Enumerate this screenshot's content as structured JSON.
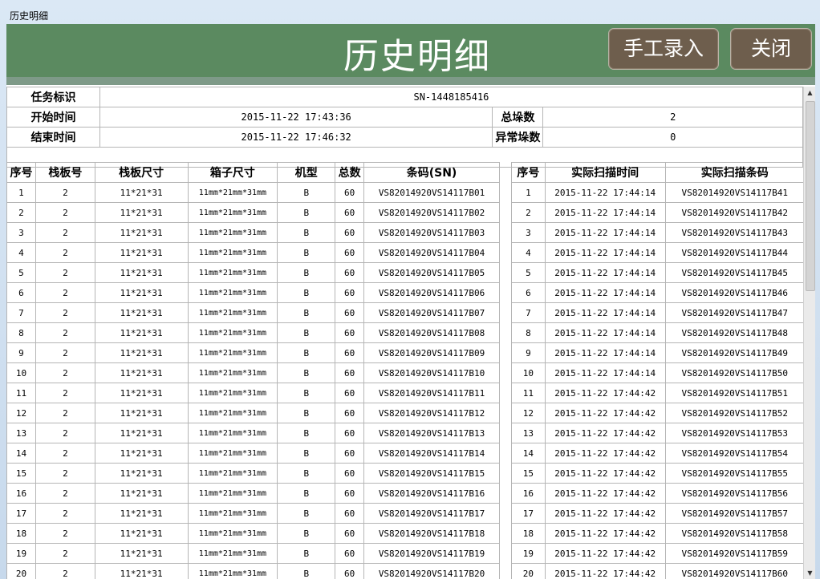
{
  "window": {
    "title": "历史明细"
  },
  "header": {
    "title": "历史明细",
    "manual_entry_label": "手工录入",
    "close_label": "关闭"
  },
  "info": {
    "task_id_label": "任务标识",
    "task_id": "SN-1448185416",
    "start_label": "开始时间",
    "start_time": "2015-11-22 17:43:36",
    "end_label": "结束时间",
    "end_time": "2015-11-22 17:46:32",
    "total_label": "总垛数",
    "total": "2",
    "abnormal_label": "异常垛数",
    "abnormal": "0"
  },
  "left_table": {
    "headers": [
      "序号",
      "栈板号",
      "栈板尺寸",
      "箱子尺寸",
      "机型",
      "总数",
      "条码(SN)"
    ],
    "rows": [
      [
        "1",
        "2",
        "11*21*31",
        "11mm*21mm*31mm",
        "B",
        "60",
        "VS82014920VS14117B01"
      ],
      [
        "2",
        "2",
        "11*21*31",
        "11mm*21mm*31mm",
        "B",
        "60",
        "VS82014920VS14117B02"
      ],
      [
        "3",
        "2",
        "11*21*31",
        "11mm*21mm*31mm",
        "B",
        "60",
        "VS82014920VS14117B03"
      ],
      [
        "4",
        "2",
        "11*21*31",
        "11mm*21mm*31mm",
        "B",
        "60",
        "VS82014920VS14117B04"
      ],
      [
        "5",
        "2",
        "11*21*31",
        "11mm*21mm*31mm",
        "B",
        "60",
        "VS82014920VS14117B05"
      ],
      [
        "6",
        "2",
        "11*21*31",
        "11mm*21mm*31mm",
        "B",
        "60",
        "VS82014920VS14117B06"
      ],
      [
        "7",
        "2",
        "11*21*31",
        "11mm*21mm*31mm",
        "B",
        "60",
        "VS82014920VS14117B07"
      ],
      [
        "8",
        "2",
        "11*21*31",
        "11mm*21mm*31mm",
        "B",
        "60",
        "VS82014920VS14117B08"
      ],
      [
        "9",
        "2",
        "11*21*31",
        "11mm*21mm*31mm",
        "B",
        "60",
        "VS82014920VS14117B09"
      ],
      [
        "10",
        "2",
        "11*21*31",
        "11mm*21mm*31mm",
        "B",
        "60",
        "VS82014920VS14117B10"
      ],
      [
        "11",
        "2",
        "11*21*31",
        "11mm*21mm*31mm",
        "B",
        "60",
        "VS82014920VS14117B11"
      ],
      [
        "12",
        "2",
        "11*21*31",
        "11mm*21mm*31mm",
        "B",
        "60",
        "VS82014920VS14117B12"
      ],
      [
        "13",
        "2",
        "11*21*31",
        "11mm*21mm*31mm",
        "B",
        "60",
        "VS82014920VS14117B13"
      ],
      [
        "14",
        "2",
        "11*21*31",
        "11mm*21mm*31mm",
        "B",
        "60",
        "VS82014920VS14117B14"
      ],
      [
        "15",
        "2",
        "11*21*31",
        "11mm*21mm*31mm",
        "B",
        "60",
        "VS82014920VS14117B15"
      ],
      [
        "16",
        "2",
        "11*21*31",
        "11mm*21mm*31mm",
        "B",
        "60",
        "VS82014920VS14117B16"
      ],
      [
        "17",
        "2",
        "11*21*31",
        "11mm*21mm*31mm",
        "B",
        "60",
        "VS82014920VS14117B17"
      ],
      [
        "18",
        "2",
        "11*21*31",
        "11mm*21mm*31mm",
        "B",
        "60",
        "VS82014920VS14117B18"
      ],
      [
        "19",
        "2",
        "11*21*31",
        "11mm*21mm*31mm",
        "B",
        "60",
        "VS82014920VS14117B19"
      ],
      [
        "20",
        "2",
        "11*21*31",
        "11mm*21mm*31mm",
        "B",
        "60",
        "VS82014920VS14117B20"
      ]
    ]
  },
  "right_table": {
    "headers": [
      "序号",
      "实际扫描时间",
      "实际扫描条码"
    ],
    "rows": [
      [
        "1",
        "2015-11-22 17:44:14",
        "VS82014920VS14117B41"
      ],
      [
        "2",
        "2015-11-22 17:44:14",
        "VS82014920VS14117B42"
      ],
      [
        "3",
        "2015-11-22 17:44:14",
        "VS82014920VS14117B43"
      ],
      [
        "4",
        "2015-11-22 17:44:14",
        "VS82014920VS14117B44"
      ],
      [
        "5",
        "2015-11-22 17:44:14",
        "VS82014920VS14117B45"
      ],
      [
        "6",
        "2015-11-22 17:44:14",
        "VS82014920VS14117B46"
      ],
      [
        "7",
        "2015-11-22 17:44:14",
        "VS82014920VS14117B47"
      ],
      [
        "8",
        "2015-11-22 17:44:14",
        "VS82014920VS14117B48"
      ],
      [
        "9",
        "2015-11-22 17:44:14",
        "VS82014920VS14117B49"
      ],
      [
        "10",
        "2015-11-22 17:44:14",
        "VS82014920VS14117B50"
      ],
      [
        "11",
        "2015-11-22 17:44:42",
        "VS82014920VS14117B51"
      ],
      [
        "12",
        "2015-11-22 17:44:42",
        "VS82014920VS14117B52"
      ],
      [
        "13",
        "2015-11-22 17:44:42",
        "VS82014920VS14117B53"
      ],
      [
        "14",
        "2015-11-22 17:44:42",
        "VS82014920VS14117B54"
      ],
      [
        "15",
        "2015-11-22 17:44:42",
        "VS82014920VS14117B55"
      ],
      [
        "16",
        "2015-11-22 17:44:42",
        "VS82014920VS14117B56"
      ],
      [
        "17",
        "2015-11-22 17:44:42",
        "VS82014920VS14117B57"
      ],
      [
        "18",
        "2015-11-22 17:44:42",
        "VS82014920VS14117B58"
      ],
      [
        "19",
        "2015-11-22 17:44:42",
        "VS82014920VS14117B59"
      ],
      [
        "20",
        "2015-11-22 17:44:42",
        "VS82014920VS14117B60"
      ]
    ]
  }
}
